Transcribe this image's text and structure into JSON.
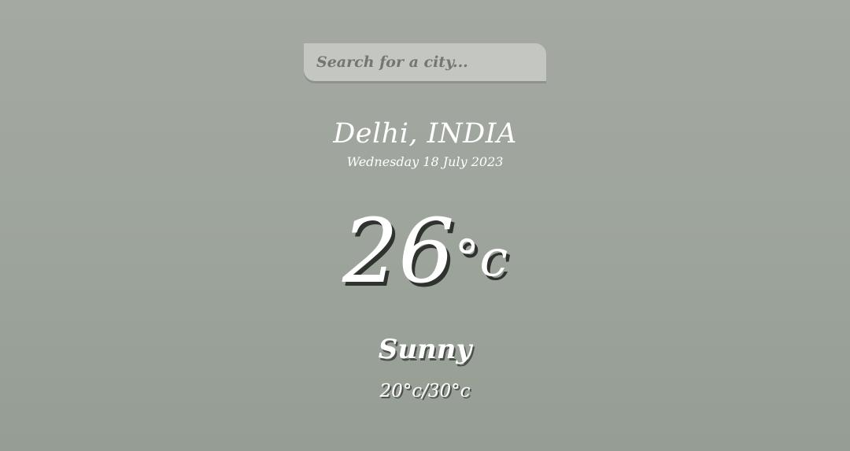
{
  "search": {
    "placeholder": "Search for a city..."
  },
  "location": {
    "city": "Delhi, INDIA",
    "date": "Wednesday 18 July 2023"
  },
  "weather": {
    "temperature": "26",
    "unit": "°c",
    "condition": "Sunny",
    "range": "20°c/30°c"
  }
}
